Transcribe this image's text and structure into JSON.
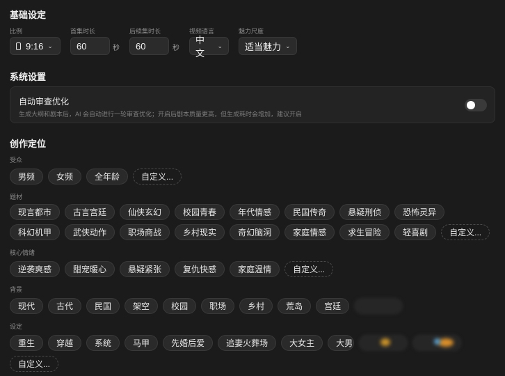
{
  "basic": {
    "title": "基础设定",
    "ratio": {
      "label": "比例",
      "value": "9:16"
    },
    "first_episode": {
      "label": "首集时长",
      "value": "60",
      "unit": "秒"
    },
    "following_episodes": {
      "label": "后续集时长",
      "value": "60",
      "unit": "秒"
    },
    "language": {
      "label": "视频语言",
      "value": "中文"
    },
    "charm": {
      "label": "魅力尺度",
      "value": "适当魅力"
    }
  },
  "system": {
    "title": "系统设置",
    "auto_review": {
      "title": "自动审查优化",
      "description": "生成大纲和剧本后，AI 会自动进行一轮审查优化；开启后剧本质量更高，但生成耗时会增加，建议开启",
      "enabled": false
    }
  },
  "positioning": {
    "title": "创作定位",
    "audience": {
      "label": "受众",
      "tags": [
        "男频",
        "女频",
        "全年龄"
      ],
      "custom": "自定义..."
    },
    "genre": {
      "label": "题材",
      "tags": [
        "现言都市",
        "古言宫廷",
        "仙侠玄幻",
        "校园青春",
        "年代情感",
        "民国传奇",
        "悬疑刑侦",
        "恐怖灵异",
        "科幻机甲",
        "武侠动作",
        "职场商战",
        "乡村现实",
        "奇幻脑洞",
        "家庭情感",
        "求生冒险",
        "轻喜剧"
      ],
      "custom": "自定义..."
    },
    "emotion": {
      "label": "核心情绪",
      "tags": [
        "逆袭爽感",
        "甜宠暖心",
        "悬疑紧张",
        "复仇快感",
        "家庭温情"
      ],
      "custom": "自定义..."
    },
    "background": {
      "label": "背景",
      "tags": [
        "现代",
        "古代",
        "民国",
        "架空",
        "校园",
        "职场",
        "乡村",
        "荒岛",
        "宫廷"
      ]
    },
    "setting": {
      "label": "设定",
      "tags": [
        "重生",
        "穿越",
        "系统",
        "马甲",
        "先婚后爱",
        "追妻火葬场",
        "大女主",
        "大男"
      ],
      "custom": "自定义..."
    }
  },
  "colors": {
    "background": "#1b1b1b",
    "chip": "#2a2a2a",
    "toggle_off": "#3a3a3a"
  }
}
